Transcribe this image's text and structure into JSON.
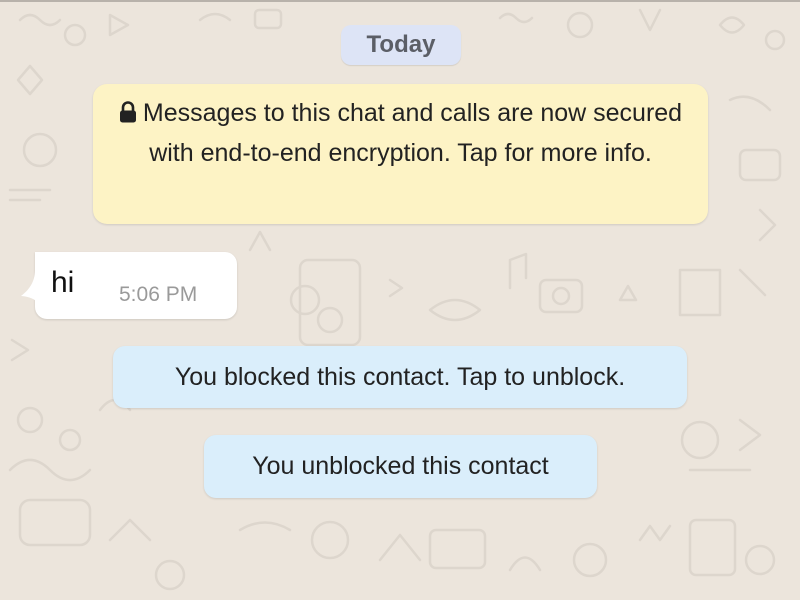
{
  "chat": {
    "date_separator": "Today",
    "encryption_notice": {
      "icon": "lock-icon",
      "text": "Messages to this chat and calls are now secured with end-to-end encryption. Tap for more info."
    },
    "messages": [
      {
        "direction": "incoming",
        "text": "hi",
        "time": "5:06 PM"
      }
    ],
    "system_notices": {
      "blocked": "You blocked this contact. Tap to unblock.",
      "unblocked": "You unblocked this contact"
    }
  },
  "colors": {
    "wallpaper": "#ece5dc",
    "date_pill": "#dde4f6",
    "encryption_notice": "#fdf3c5",
    "incoming_bubble": "#ffffff",
    "system_notice": "#daeefb"
  }
}
